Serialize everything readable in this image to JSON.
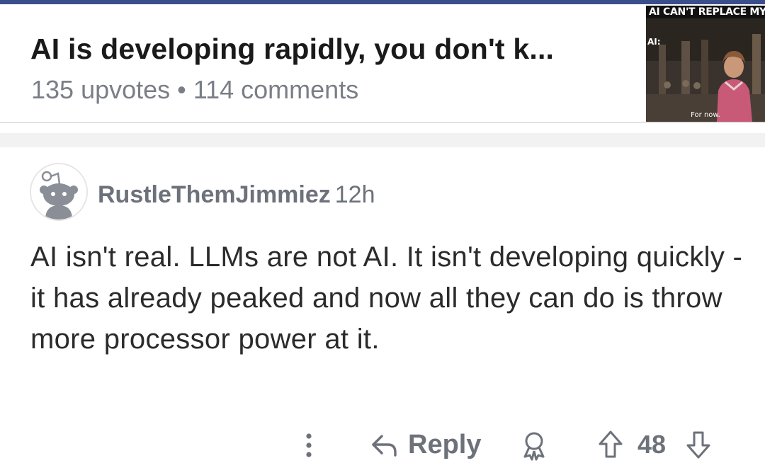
{
  "post": {
    "title": "AI is developing rapidly, you don't k...",
    "upvotes": "135 upvotes",
    "separator": "•",
    "comments": "114 comments",
    "thumbnail": {
      "caption": "AI CAN'T REPLACE MY JOB",
      "speaker": "AI:",
      "subtitle": "For now."
    }
  },
  "comment": {
    "author": "RustleThemJimmiez",
    "age": "12h",
    "body": "AI isn't real. LLMs are not AI. It isn't developing quickly - it has already peaked and now all they can do is throw more processor power at it.",
    "actions": {
      "reply_label": "Reply",
      "score": "48"
    }
  },
  "colors": {
    "accent_bar": "#3a4e8c",
    "meta_text": "#7a7e86",
    "action_text": "#6c717a"
  },
  "icons": [
    "more-vertical-icon",
    "reply-arrow-icon",
    "award-icon",
    "upvote-arrow-icon",
    "downvote-arrow-icon",
    "default-avatar-icon"
  ]
}
